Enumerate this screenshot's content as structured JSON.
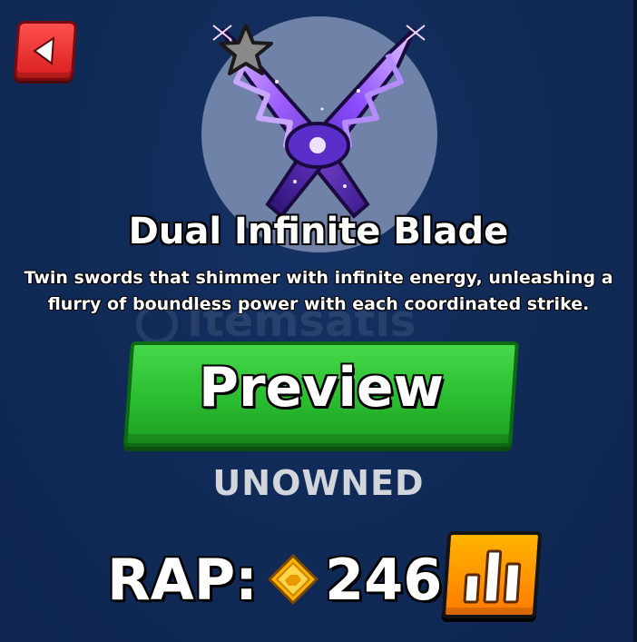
{
  "item": {
    "name": "Dual Infinite Blade",
    "description": "Twin swords that shimmer with infinite energy, unleashing a flurry of boundless power with each coordinated strike.",
    "status": "UNOWNED",
    "rarity_icon": "star-icon"
  },
  "actions": {
    "preview_label": "Preview",
    "back_icon": "back-arrow-icon",
    "stats_icon": "bar-chart-icon"
  },
  "rap": {
    "label": "RAP:",
    "value": "246",
    "currency_icon": "gem-coin-icon"
  },
  "watermark": {
    "text": "Itemsatis"
  },
  "colors": {
    "background": "#112b58",
    "preview_green": "#2bbd30",
    "back_red": "#e02a2a",
    "stats_orange": "#ff9a00",
    "coin_gold": "#ffc21a",
    "status_gray": "#d2d6dc"
  }
}
